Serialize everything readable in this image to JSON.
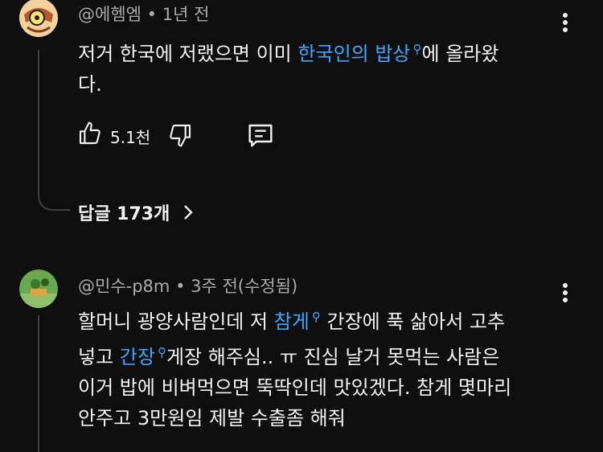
{
  "comments": [
    {
      "author": "@에헴엠",
      "time": "1년 전",
      "text_parts": [
        "저거 한국에 저랬으면 이미 ",
        "한국인의 밥상",
        "에 올라왔",
        "다."
      ],
      "likes": "5.1천",
      "replies_label": "답글 173개",
      "icons": {
        "like": "thumbs-up-icon",
        "dislike": "thumbs-down-icon",
        "reply": "comment-icon",
        "more": "more-vert-icon",
        "link": "search-icon",
        "expand": "chevron-right-icon"
      }
    },
    {
      "author": "@민수-p8m",
      "time": "3주 전(수정됨)",
      "line1_a": "할머니 광양사람인데 저 ",
      "line1_link": "참게",
      "line1_b": " 간장에 푹 삶아서 고추",
      "line2_a": "넣고 ",
      "line2_link": "간장",
      "line2_b": "게장 해주심.. ㅠ 진심 날거 못먹는 사람은",
      "line3": "이거 밥에 비벼먹으면 뚝딱인데 맛있겠다. 참게 몇마리",
      "line4": "안주고 3만원임 제발 수출좀 해줘"
    }
  ],
  "colors": {
    "background": "#0f0f0f",
    "link": "#3ea6ff",
    "meta": "#aaaaaa",
    "text": "#f1f1f1"
  }
}
